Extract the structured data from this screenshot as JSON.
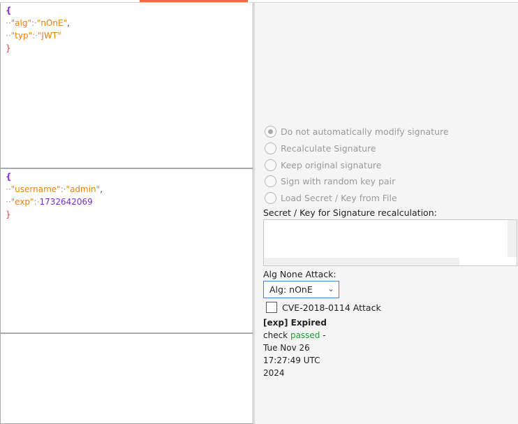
{
  "header_json": {
    "open": "{",
    "lines": [
      {
        "dots": "··",
        "key": "\"alg\"",
        "sep": ":·",
        "value": "\"nOnE\"",
        "comma": ","
      },
      {
        "dots": "··",
        "key": "\"typ\"",
        "sep": ":·",
        "value": "\"JWT\"",
        "comma": ""
      }
    ],
    "close": "}"
  },
  "payload_json": {
    "open": "{",
    "lines": [
      {
        "dots": "··",
        "key": "\"username\"",
        "sep": ":·",
        "value": "\"admin\"",
        "comma": ","
      },
      {
        "dots": "··",
        "key": "\"exp\"",
        "sep": ":·",
        "value": "1732642069",
        "comma": ""
      }
    ],
    "close": "}"
  },
  "signature_options": [
    {
      "label": "Do not automatically modify signature",
      "checked": true
    },
    {
      "label": "Recalculate Signature",
      "checked": false
    },
    {
      "label": "Keep original signature",
      "checked": false
    },
    {
      "label": "Sign with random key pair",
      "checked": false
    },
    {
      "label": "Load Secret / Key from File",
      "checked": false
    }
  ],
  "secret_label": "Secret / Key for Signature recalculation:",
  "alg_none_label": "Alg None Attack:",
  "alg_select_value": "Alg: nOnE",
  "cve_label": "CVE-2018-0114 Attack",
  "status": {
    "line1": "[exp] Expired",
    "check": "check ",
    "passed": "passed",
    "dash": " -",
    "line3": "Tue Nov 26",
    "line4": "17:27:49 UTC",
    "line5": "2024"
  },
  "colors": {
    "accent_tab": "#f26b3a",
    "json_key": "#e8820c",
    "json_number": "#7b2fcf",
    "passed": "#1f9a2e"
  }
}
